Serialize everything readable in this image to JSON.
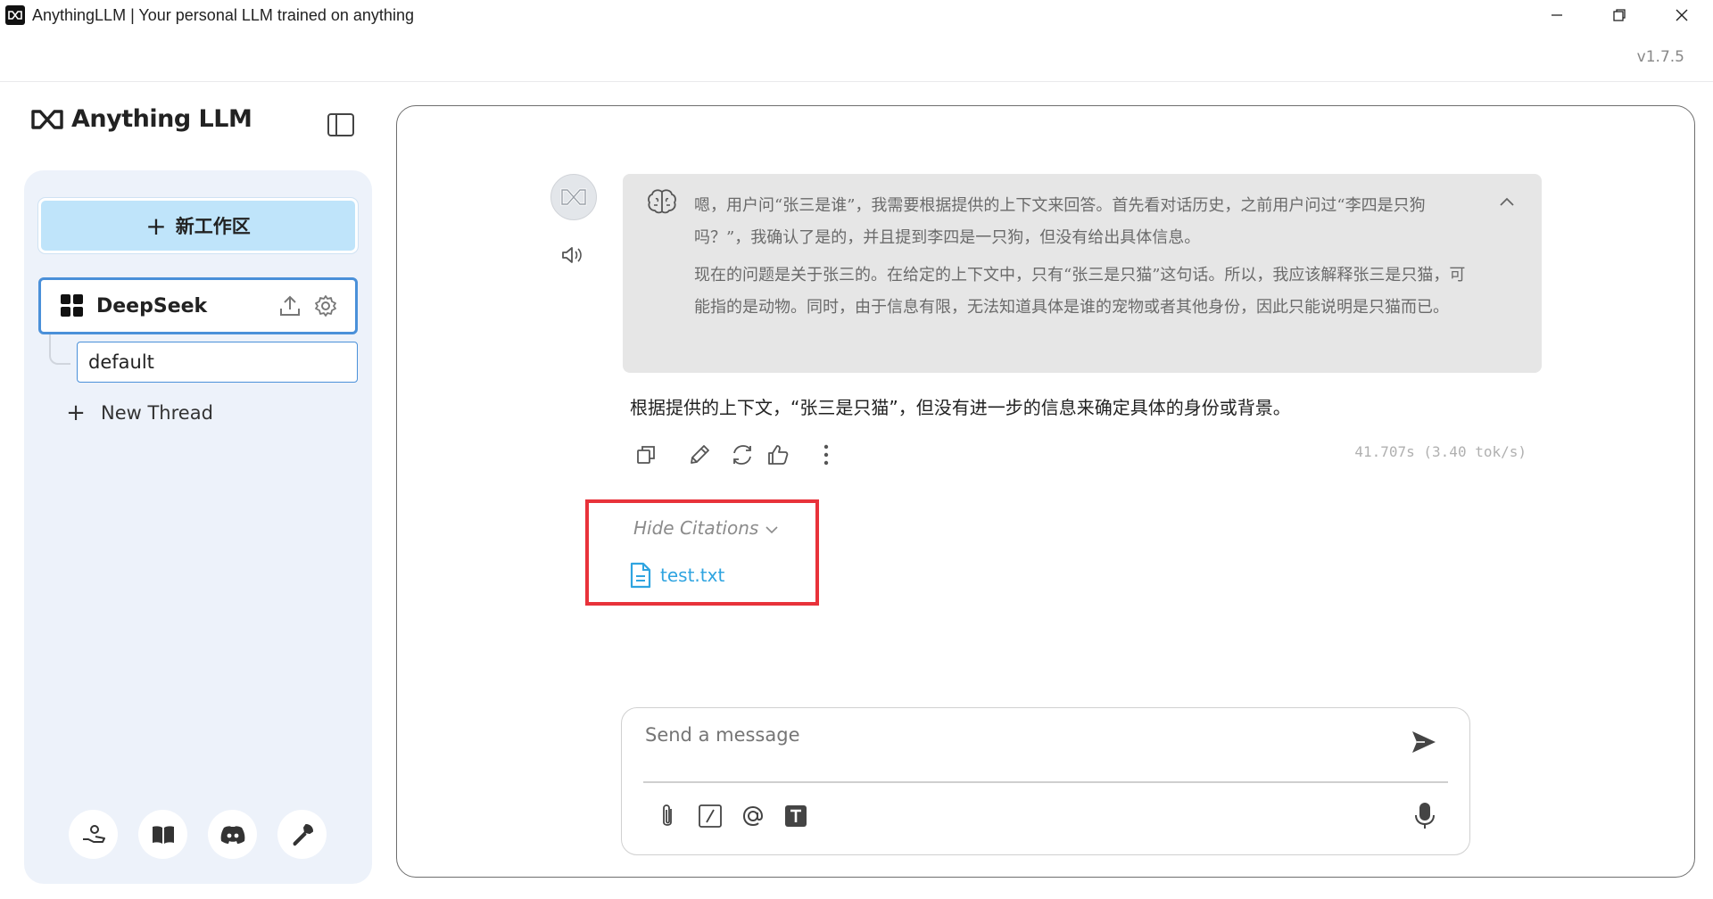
{
  "window": {
    "title": "AnythingLLM | Your personal LLM trained on anything",
    "controls": [
      "minimize-icon",
      "restore-icon",
      "close-icon"
    ]
  },
  "version": "v1.7.5",
  "sidebar": {
    "brand": "Anything LLM",
    "new_workspace_label": "新工作区",
    "workspace": {
      "name": "DeepSeek",
      "icons": [
        "upload-icon",
        "gear-icon"
      ]
    },
    "thread": "default",
    "new_thread_label": "New Thread",
    "footer_icons": [
      "support-hand-icon",
      "docs-book-icon",
      "discord-icon",
      "settings-wrench-icon"
    ]
  },
  "chat": {
    "thought": {
      "paragraphs": [
        "嗯，用户问“张三是谁”，我需要根据提供的上下文来回答。首先看对话历史，之前用户问过“李四是只狗吗？”，我确认了是的，并且提到李四是一只狗，但没有给出具体信息。",
        "现在的问题是关于张三的。在给定的上下文中，只有“张三是只猫”这句话。所以，我应该解释张三是只猫，可能指的是动物。同时，由于信息有限，无法知道具体是谁的宠物或者其他身份，因此只能说明是只猫而已。"
      ]
    },
    "answer": "根据提供的上下文，“张三是只猫”，但没有进一步的信息来确定具体的身份或背景。",
    "stats": "41.707s (3.40 tok/s)",
    "citations": {
      "toggle_label": "Hide Citations",
      "files": [
        "test.txt"
      ]
    }
  },
  "composer": {
    "placeholder": "Send a message",
    "tools": [
      "attach-icon",
      "slash-command-icon",
      "at-mention-icon",
      "text-format-icon"
    ]
  },
  "colors": {
    "accent": "#4a90d9",
    "new_workspace_bg": "#bfe4fa",
    "sidebar_bg": "#edf2fa",
    "thought_bg": "#e6e6e6",
    "citation_highlight": "#e8323a",
    "citation_link": "#2fa4e0"
  }
}
